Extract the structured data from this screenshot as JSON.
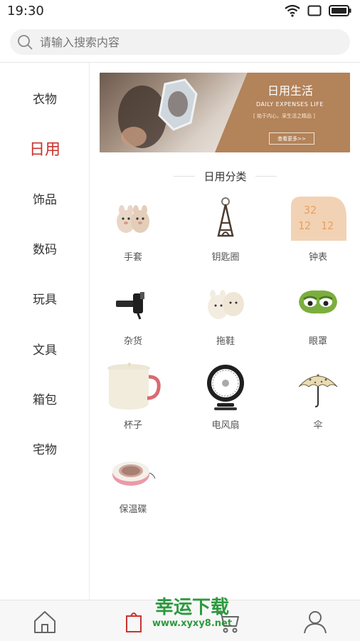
{
  "status_bar": {
    "time": "19:30"
  },
  "search": {
    "placeholder": "请输入搜索内容"
  },
  "sidebar": {
    "items": [
      {
        "label": "衣物",
        "active": false
      },
      {
        "label": "日用",
        "active": true
      },
      {
        "label": "饰品",
        "active": false
      },
      {
        "label": "数码",
        "active": false
      },
      {
        "label": "玩具",
        "active": false
      },
      {
        "label": "文具",
        "active": false
      },
      {
        "label": "箱包",
        "active": false
      },
      {
        "label": "宅物",
        "active": false
      }
    ]
  },
  "banner": {
    "title": "日用生活",
    "subtitle": "DAILY EXPENSES   LIFE",
    "slogan": "[ 始于内心，采生活之精品 ]",
    "more_label": "查看更多>>"
  },
  "section": {
    "title": "日用分类"
  },
  "categories": [
    {
      "label": "手套",
      "icon": "gloves-icon"
    },
    {
      "label": "钥匙圈",
      "icon": "keychain-icon"
    },
    {
      "label": "钟表",
      "icon": "clock-icon"
    },
    {
      "label": "杂货",
      "icon": "gadget-icon"
    },
    {
      "label": "拖鞋",
      "icon": "slippers-icon"
    },
    {
      "label": "眼罩",
      "icon": "eye-mask-icon"
    },
    {
      "label": "杯子",
      "icon": "cup-icon"
    },
    {
      "label": "电风扇",
      "icon": "fan-icon"
    },
    {
      "label": "伞",
      "icon": "umbrella-icon"
    },
    {
      "label": "保温碟",
      "icon": "warmer-icon"
    }
  ],
  "clock_display": "32 12 12",
  "bottom_nav": [
    "home-icon",
    "category-icon",
    "cart-icon",
    "user-icon"
  ],
  "watermark": {
    "title": "幸运下载",
    "url": "www.xyxy8.net"
  },
  "colors": {
    "accent": "#c9332e",
    "banner": "#b3835a",
    "watermark": "#2c9a3e"
  }
}
